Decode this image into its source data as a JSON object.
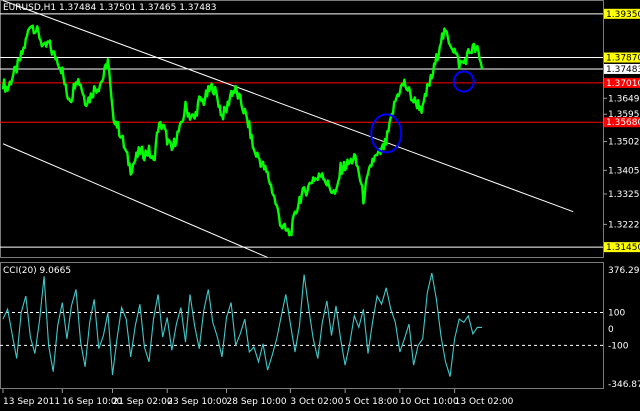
{
  "chart_data": [
    {
      "type": "line",
      "title": "EURUSD,H1  1.37484 1.37501 1.37465 1.37483",
      "symbol": "EURUSD,H1",
      "ohlc": [
        "1.37484",
        "1.37501",
        "1.37465",
        "1.37483"
      ],
      "ylim": [
        1.3115,
        1.3975
      ],
      "y_tick_labels": [
        1.3935,
        1.3787,
        1.37483,
        1.3701,
        1.3649,
        1.3595,
        1.3568,
        1.35025,
        1.3405,
        1.3325,
        1.3222,
        1.3145
      ],
      "y_tick_labels_text": [
        "1.39350",
        "1.37870",
        "1.37483",
        "1.37010",
        "1.36490",
        "1.35950",
        "1.35680",
        "1.35025",
        "1.34050",
        "1.33250",
        "1.32220",
        "1.31450"
      ],
      "highlighted_labels": [
        {
          "text": "1.39350",
          "value": 1.3935,
          "color": "#ffff00"
        },
        {
          "text": "1.37870",
          "value": 1.3787,
          "color": "#ffff00"
        },
        {
          "text": "1.37483",
          "value": 1.37483,
          "color": "#ffffff"
        },
        {
          "text": "1.37010",
          "value": 1.3701,
          "color": "#ff0000"
        },
        {
          "text": "1.35680",
          "value": 1.3568,
          "color": "#ff0000"
        },
        {
          "text": "1.31450",
          "value": 1.3145,
          "color": "#ffff00"
        }
      ],
      "horizontal_lines": [
        {
          "value": 1.3935,
          "color": "#ffffff"
        },
        {
          "value": 1.3787,
          "color": "#ffffff"
        },
        {
          "value": 1.37483,
          "color": "#ffffff"
        },
        {
          "value": 1.3701,
          "color": "#ff0000"
        },
        {
          "value": 1.3568,
          "color": "#ff0000"
        },
        {
          "value": 1.3145,
          "color": "#ffffff"
        }
      ],
      "trendlines": [
        {
          "from": {
            "bar": 0,
            "value": 1.398
          },
          "to": {
            "bar": 125,
            "value": 1.3265
          },
          "color": "#ffffff"
        },
        {
          "from": {
            "bar": 0,
            "value": 1.3495
          },
          "to": {
            "bar": 58,
            "value": 1.311
          },
          "color": "#ffffff"
        }
      ],
      "circles": [
        {
          "bar": 84,
          "value": 1.353,
          "color": "#0000ff"
        },
        {
          "bar": 101,
          "value": 1.3706,
          "color": "#0000ff"
        }
      ],
      "x_tick_labels": [
        "13 Sep 2011",
        "16 Sep 10:00",
        "21 Sep 02:00",
        "23 Sep 10:00",
        "28 Sep 10:00",
        "3 Oct 02:00",
        "5 Oct 18:00",
        "10 Oct 10:00",
        "13 Oct 02:00"
      ],
      "x_tick_bars": [
        0,
        13,
        24,
        36,
        49,
        63,
        75,
        87,
        99
      ],
      "series": [
        {
          "color": "#00ff00",
          "values": [
            1.37,
            1.368,
            1.372,
            1.375,
            1.379,
            1.384,
            1.3905,
            1.3885,
            1.386,
            1.3815,
            1.3835,
            1.38,
            1.378,
            1.374,
            1.366,
            1.365,
            1.372,
            1.37,
            1.364,
            1.365,
            1.368,
            1.369,
            1.372,
            1.378,
            1.36,
            1.356,
            1.352,
            1.346,
            1.341,
            1.344,
            1.347,
            1.346,
            1.347,
            1.343,
            1.355,
            1.356,
            1.351,
            1.347,
            1.352,
            1.355,
            1.362,
            1.359,
            1.358,
            1.364,
            1.364,
            1.367,
            1.369,
            1.365,
            1.359,
            1.361,
            1.367,
            1.3675,
            1.364,
            1.36,
            1.355,
            1.347,
            1.345,
            1.342,
            1.339,
            1.334,
            1.328,
            1.322,
            1.32,
            1.319,
            1.325,
            1.331,
            1.333,
            1.335,
            1.338,
            1.3375,
            1.34,
            1.336,
            1.334,
            1.332,
            1.341,
            1.342,
            1.343,
            1.345,
            1.34,
            1.331,
            1.338,
            1.344,
            1.345,
            1.347,
            1.35,
            1.357,
            1.364,
            1.368,
            1.37,
            1.367,
            1.364,
            1.363,
            1.361,
            1.368,
            1.372,
            1.378,
            1.385,
            1.387,
            1.384,
            1.381,
            1.3765,
            1.377,
            1.38,
            1.382,
            1.381,
            1.3748
          ]
        }
      ]
    },
    {
      "type": "line",
      "title": "CCI(20) 9.0665",
      "indicator": "CCI(20)",
      "current_value": "9.0665",
      "ylim": [
        -346.8735,
        376.2918
      ],
      "y_tick_labels": [
        376.2918,
        100,
        0,
        -100,
        -346.8735
      ],
      "y_tick_labels_text": [
        "376.2918",
        "100",
        "0",
        "-100",
        "-346.8735"
      ],
      "levels": [
        100,
        -100
      ],
      "series": [
        {
          "color": "#40c8c8",
          "values": [
            60,
            120,
            -30,
            -180,
            100,
            200,
            -50,
            -150,
            50,
            320,
            -100,
            -260,
            20,
            160,
            -60,
            140,
            240,
            -80,
            -230,
            40,
            180,
            -120,
            -40,
            100,
            -280,
            -60,
            130,
            60,
            -170,
            20,
            150,
            -110,
            -200,
            60,
            210,
            -50,
            70,
            -130,
            30,
            130,
            -80,
            210,
            20,
            -120,
            110,
            240,
            40,
            -50,
            -170,
            70,
            160,
            -100,
            -30,
            60,
            -140,
            -110,
            -200,
            -90,
            -250,
            -160,
            -60,
            80,
            210,
            30,
            -140,
            20,
            330,
            130,
            -60,
            -180,
            40,
            170,
            -40,
            140,
            -60,
            -220,
            -90,
            80,
            10,
            120,
            -150,
            40,
            200,
            150,
            250,
            120,
            40,
            -140,
            -60,
            30,
            -220,
            -100,
            -60,
            220,
            340,
            180,
            -40,
            -200,
            -290,
            -60,
            60,
            40,
            80,
            -30,
            10,
            9.0665
          ]
        }
      ]
    }
  ]
}
